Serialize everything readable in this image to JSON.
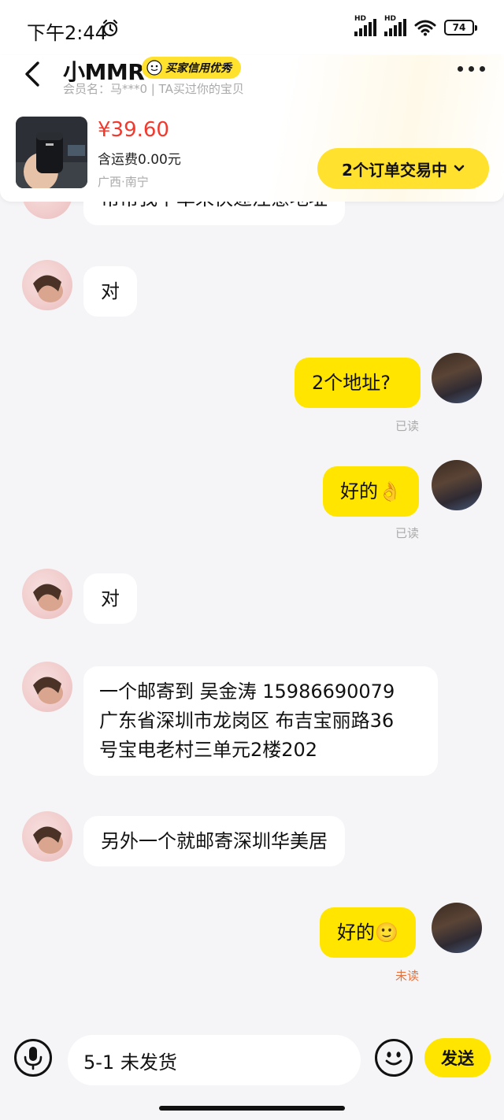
{
  "status_bar": {
    "time": "下午2:44",
    "signal_label_1": "HD",
    "signal_label_2": "HD",
    "battery": "74"
  },
  "header": {
    "nickname": "小MMR",
    "credit_badge": "买家信用优秀",
    "member_info": "会员名：马***0  |  TA买过你的宝贝"
  },
  "product": {
    "price": "¥39.60",
    "shipping": "含运费0.00元",
    "location": "广西·南宁",
    "orders_button": "2个订单交易中"
  },
  "messages": [
    {
      "side": "left",
      "text": "帮帮我下单来快递注意地址"
    },
    {
      "side": "left",
      "text": "对"
    },
    {
      "side": "right",
      "text": "2个地址?",
      "status": "已读"
    },
    {
      "side": "right",
      "text": "好的👌",
      "status": "已读"
    },
    {
      "side": "left",
      "text": "对"
    },
    {
      "side": "left",
      "lines": [
        "一个邮寄到 吴金涛 15986690079",
        "广东省深圳市龙岗区 布吉宝丽路36",
        "号宝电老村三单元2楼202"
      ]
    },
    {
      "side": "left",
      "text": "另外一个就邮寄深圳华美居"
    },
    {
      "side": "right",
      "text": "好的🙂",
      "status": "未读"
    }
  ],
  "input": {
    "value": "5-1  未发货",
    "send_label": "发送"
  },
  "colors": {
    "accent_yellow": "#ffe500",
    "price_red": "#f03a2e",
    "unread_orange": "#e8713a",
    "background": "#f5f5f7"
  },
  "icons": [
    "alarm-icon",
    "back-icon",
    "more-icon",
    "chevron-down-icon",
    "microphone-icon",
    "emoji-icon"
  ]
}
